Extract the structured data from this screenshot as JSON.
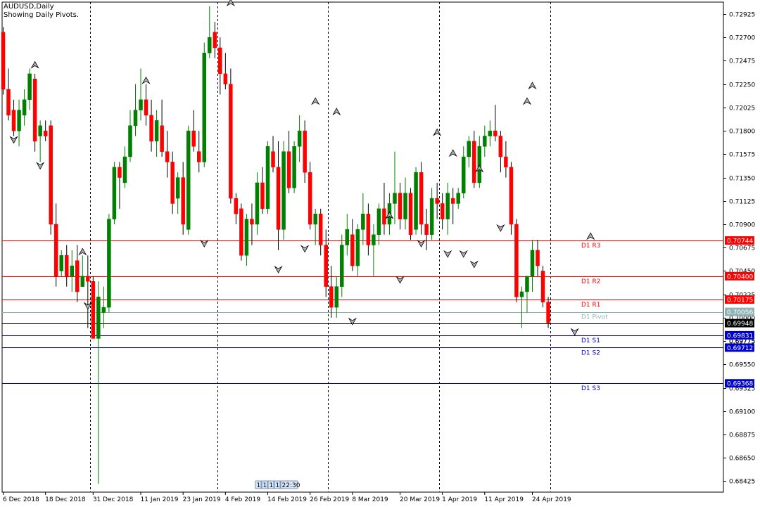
{
  "header": {
    "title": "AUDUSD,Daily",
    "subtitle": "Showing Daily Pivots."
  },
  "chart_data": {
    "type": "candlestick",
    "symbol": "AUDUSD",
    "timeframe": "Daily",
    "ylim": [
      0.6832,
      0.7304
    ],
    "price_ticks": [
      "0.72925",
      "0.72700",
      "0.72475",
      "0.72250",
      "0.72025",
      "0.71800",
      "0.71575",
      "0.71350",
      "0.71125",
      "0.70900",
      "0.70675",
      "0.70450",
      "0.70225",
      "0.70000",
      "0.69775",
      "0.69550",
      "0.69325",
      "0.69100",
      "0.68875",
      "0.68650",
      "0.68425"
    ],
    "date_ticks": [
      {
        "label": "6 Dec 2018",
        "idx": 0
      },
      {
        "label": "18 Dec 2018",
        "idx": 8
      },
      {
        "label": "31 Dec 2018",
        "idx": 17
      },
      {
        "label": "11 Jan 2019",
        "idx": 26
      },
      {
        "label": "23 Jan 2019",
        "idx": 34
      },
      {
        "label": "4 Feb 2019",
        "idx": 42
      },
      {
        "label": "14 Feb 2019",
        "idx": 50
      },
      {
        "label": "26 Feb 2019",
        "idx": 58
      },
      {
        "label": "8 Mar 2019",
        "idx": 66
      },
      {
        "label": "20 Mar 2019",
        "idx": 75
      },
      {
        "label": "1 Apr 2019",
        "idx": 83
      },
      {
        "label": "11 Apr 2019",
        "idx": 91
      },
      {
        "label": "24 Apr 2019",
        "idx": 100
      }
    ],
    "period_separators": [
      17,
      41,
      62,
      83,
      104
    ],
    "candles": [
      [
        0.7275,
        0.728,
        0.7215,
        0.722
      ],
      [
        0.722,
        0.724,
        0.719,
        0.7195
      ],
      [
        0.72,
        0.721,
        0.7175,
        0.718
      ],
      [
        0.718,
        0.721,
        0.7165,
        0.72
      ],
      [
        0.7195,
        0.722,
        0.7185,
        0.721
      ],
      [
        0.721,
        0.724,
        0.72,
        0.7235
      ],
      [
        0.723,
        0.7235,
        0.716,
        0.717
      ],
      [
        0.7175,
        0.719,
        0.715,
        0.7185
      ],
      [
        0.718,
        0.719,
        0.717,
        0.7175
      ],
      [
        0.7185,
        0.719,
        0.708,
        0.709
      ],
      [
        0.709,
        0.711,
        0.703,
        0.704
      ],
      [
        0.7045,
        0.7065,
        0.704,
        0.706
      ],
      [
        0.706,
        0.707,
        0.703,
        0.704
      ],
      [
        0.704,
        0.7065,
        0.7025,
        0.705
      ],
      [
        0.7055,
        0.707,
        0.7015,
        0.7025
      ],
      [
        0.703,
        0.706,
        0.703,
        0.704
      ],
      [
        0.704,
        0.706,
        0.699,
        0.7035
      ],
      [
        0.7035,
        0.704,
        0.698,
        0.698
      ],
      [
        0.698,
        0.7035,
        0.684,
        0.702
      ],
      [
        0.7005,
        0.703,
        0.699,
        0.701
      ],
      [
        0.701,
        0.71,
        0.7005,
        0.7095
      ],
      [
        0.7095,
        0.715,
        0.709,
        0.7145
      ],
      [
        0.7145,
        0.715,
        0.7105,
        0.7135
      ],
      [
        0.713,
        0.7165,
        0.7125,
        0.7155
      ],
      [
        0.7155,
        0.72,
        0.715,
        0.7185
      ],
      [
        0.7185,
        0.7225,
        0.7175,
        0.72
      ],
      [
        0.72,
        0.724,
        0.719,
        0.721
      ],
      [
        0.721,
        0.7225,
        0.7185,
        0.7195
      ],
      [
        0.7195,
        0.721,
        0.716,
        0.717
      ],
      [
        0.717,
        0.72,
        0.7155,
        0.719
      ],
      [
        0.7185,
        0.721,
        0.7155,
        0.716
      ],
      [
        0.716,
        0.718,
        0.7135,
        0.715
      ],
      [
        0.715,
        0.716,
        0.71,
        0.711
      ],
      [
        0.7115,
        0.714,
        0.71,
        0.7135
      ],
      [
        0.7135,
        0.715,
        0.708,
        0.709
      ],
      [
        0.7085,
        0.7185,
        0.708,
        0.718
      ],
      [
        0.718,
        0.72,
        0.716,
        0.7165
      ],
      [
        0.716,
        0.718,
        0.714,
        0.715
      ],
      [
        0.715,
        0.7265,
        0.7145,
        0.7255
      ],
      [
        0.7255,
        0.73,
        0.725,
        0.727
      ],
      [
        0.7275,
        0.7285,
        0.725,
        0.726
      ],
      [
        0.726,
        0.727,
        0.7215,
        0.7235
      ],
      [
        0.7235,
        0.7255,
        0.722,
        0.7225
      ],
      [
        0.7225,
        0.724,
        0.711,
        0.7115
      ],
      [
        0.7115,
        0.712,
        0.709,
        0.71
      ],
      [
        0.7105,
        0.711,
        0.7055,
        0.706
      ],
      [
        0.706,
        0.71,
        0.705,
        0.7095
      ],
      [
        0.7095,
        0.711,
        0.707,
        0.709
      ],
      [
        0.709,
        0.714,
        0.708,
        0.713
      ],
      [
        0.713,
        0.7145,
        0.71,
        0.7105
      ],
      [
        0.7105,
        0.717,
        0.71,
        0.7165
      ],
      [
        0.716,
        0.7175,
        0.714,
        0.7145
      ],
      [
        0.7145,
        0.717,
        0.7065,
        0.7085
      ],
      [
        0.7085,
        0.717,
        0.7075,
        0.716
      ],
      [
        0.716,
        0.718,
        0.712,
        0.7125
      ],
      [
        0.7125,
        0.717,
        0.712,
        0.7165
      ],
      [
        0.7165,
        0.7195,
        0.715,
        0.718
      ],
      [
        0.718,
        0.719,
        0.713,
        0.714
      ],
      [
        0.714,
        0.715,
        0.7085,
        0.709
      ],
      [
        0.709,
        0.7105,
        0.707,
        0.71
      ],
      [
        0.71,
        0.7105,
        0.706,
        0.707
      ],
      [
        0.707,
        0.7085,
        0.702,
        0.703
      ],
      [
        0.703,
        0.705,
        0.7,
        0.701
      ],
      [
        0.701,
        0.704,
        0.7,
        0.703
      ],
      [
        0.703,
        0.708,
        0.702,
        0.707
      ],
      [
        0.707,
        0.71,
        0.706,
        0.7085
      ],
      [
        0.708,
        0.7095,
        0.7045,
        0.705
      ],
      [
        0.705,
        0.709,
        0.704,
        0.7085
      ],
      [
        0.7085,
        0.712,
        0.707,
        0.71
      ],
      [
        0.71,
        0.711,
        0.706,
        0.707
      ],
      [
        0.707,
        0.709,
        0.704,
        0.708
      ],
      [
        0.708,
        0.711,
        0.707,
        0.7105
      ],
      [
        0.7105,
        0.713,
        0.708,
        0.709
      ],
      [
        0.709,
        0.712,
        0.708,
        0.711
      ],
      [
        0.711,
        0.716,
        0.709,
        0.712
      ],
      [
        0.712,
        0.713,
        0.7085,
        0.7095
      ],
      [
        0.7095,
        0.7135,
        0.7085,
        0.712
      ],
      [
        0.712,
        0.7125,
        0.7075,
        0.708
      ],
      [
        0.7085,
        0.7145,
        0.708,
        0.714
      ],
      [
        0.714,
        0.715,
        0.708,
        0.709
      ],
      [
        0.709,
        0.7105,
        0.7065,
        0.708
      ],
      [
        0.708,
        0.7125,
        0.7075,
        0.7115
      ],
      [
        0.7115,
        0.713,
        0.7095,
        0.711
      ],
      [
        0.711,
        0.712,
        0.7085,
        0.7095
      ],
      [
        0.7095,
        0.713,
        0.708,
        0.712
      ],
      [
        0.7115,
        0.7125,
        0.709,
        0.711
      ],
      [
        0.711,
        0.7125,
        0.7105,
        0.712
      ],
      [
        0.712,
        0.7165,
        0.7115,
        0.7155
      ],
      [
        0.7155,
        0.7175,
        0.7145,
        0.717
      ],
      [
        0.717,
        0.718,
        0.7125,
        0.713
      ],
      [
        0.713,
        0.7175,
        0.7125,
        0.7165
      ],
      [
        0.7165,
        0.7185,
        0.7155,
        0.7175
      ],
      [
        0.7175,
        0.719,
        0.7165,
        0.718
      ],
      [
        0.718,
        0.7205,
        0.717,
        0.7175
      ],
      [
        0.7175,
        0.718,
        0.714,
        0.7155
      ],
      [
        0.7155,
        0.717,
        0.7135,
        0.7145
      ],
      [
        0.7145,
        0.715,
        0.708,
        0.709
      ],
      [
        0.709,
        0.7095,
        0.7015,
        0.702
      ],
      [
        0.702,
        0.703,
        0.699,
        0.7025
      ],
      [
        0.7025,
        0.7035,
        0.7005,
        0.704
      ],
      [
        0.704,
        0.7075,
        0.7025,
        0.7065
      ],
      [
        0.7065,
        0.7075,
        0.704,
        0.705
      ],
      [
        0.7045,
        0.705,
        0.701,
        0.7015
      ],
      [
        0.7015,
        0.702,
        0.699,
        0.6995
      ]
    ],
    "fractals": [
      {
        "idx": 2,
        "dir": "down",
        "price": 0.7175
      },
      {
        "idx": 6,
        "dir": "up",
        "price": 0.724
      },
      {
        "idx": 7,
        "dir": "down",
        "price": 0.715
      },
      {
        "idx": 15,
        "dir": "up",
        "price": 0.706
      },
      {
        "idx": 16,
        "dir": "down",
        "price": 0.7015
      },
      {
        "idx": 27,
        "dir": "up",
        "price": 0.7225
      },
      {
        "idx": 38,
        "dir": "down",
        "price": 0.7075
      },
      {
        "idx": 43,
        "dir": "up",
        "price": 0.73
      },
      {
        "idx": 52,
        "dir": "down",
        "price": 0.705
      },
      {
        "idx": 57,
        "dir": "down",
        "price": 0.707
      },
      {
        "idx": 59,
        "dir": "up",
        "price": 0.7205
      },
      {
        "idx": 63,
        "dir": "up",
        "price": 0.7195
      },
      {
        "idx": 66,
        "dir": "down",
        "price": 0.7
      },
      {
        "idx": 73,
        "dir": "up",
        "price": 0.7095
      },
      {
        "idx": 75,
        "dir": "down",
        "price": 0.704
      },
      {
        "idx": 79,
        "dir": "down",
        "price": 0.7075
      },
      {
        "idx": 82,
        "dir": "up",
        "price": 0.7175
      },
      {
        "idx": 84,
        "dir": "down",
        "price": 0.7065
      },
      {
        "idx": 85,
        "dir": "up",
        "price": 0.7155
      },
      {
        "idx": 87,
        "dir": "down",
        "price": 0.7065
      },
      {
        "idx": 89,
        "dir": "down",
        "price": 0.7055
      },
      {
        "idx": 90,
        "dir": "up",
        "price": 0.714
      },
      {
        "idx": 94,
        "dir": "down",
        "price": 0.709
      },
      {
        "idx": 99,
        "dir": "up",
        "price": 0.7205
      },
      {
        "idx": 100,
        "dir": "up",
        "price": 0.722
      },
      {
        "idx": 108,
        "dir": "down",
        "price": 0.699
      },
      {
        "idx": 111,
        "dir": "up",
        "price": 0.7075
      }
    ],
    "pivots": [
      {
        "label": "D1 R3",
        "value": 0.70744,
        "tag": "0.70744",
        "color": "#ff0000"
      },
      {
        "label": "D1 R2",
        "value": 0.704,
        "tag": "0.70400",
        "color": "#ff0000"
      },
      {
        "label": "D1 R1",
        "value": 0.70175,
        "tag": "0.70175",
        "color": "#ff0000"
      },
      {
        "label": "D1 Pivot",
        "value": 0.70056,
        "tag": "0.70056",
        "color": "#8fb3b3"
      },
      {
        "label": "D1 S1",
        "value": 0.69831,
        "tag": "0.69831",
        "color": "#0000cc"
      },
      {
        "label": "D1 S2",
        "value": 0.69712,
        "tag": "0.69712",
        "color": "#0000cc"
      },
      {
        "label": "D1 S3",
        "value": 0.69368,
        "tag": "0.69368",
        "color": "#0000cc"
      }
    ],
    "bid": {
      "value": 0.69948,
      "tag": "0.69948"
    },
    "hidden_tick": "0.69775",
    "scroll_labels": [
      "1",
      "1",
      "1",
      "1",
      "22:30"
    ],
    "colors": {
      "bull": "#008000",
      "bear": "#ff0000",
      "wick": "#000000",
      "grid": "#000000"
    }
  }
}
